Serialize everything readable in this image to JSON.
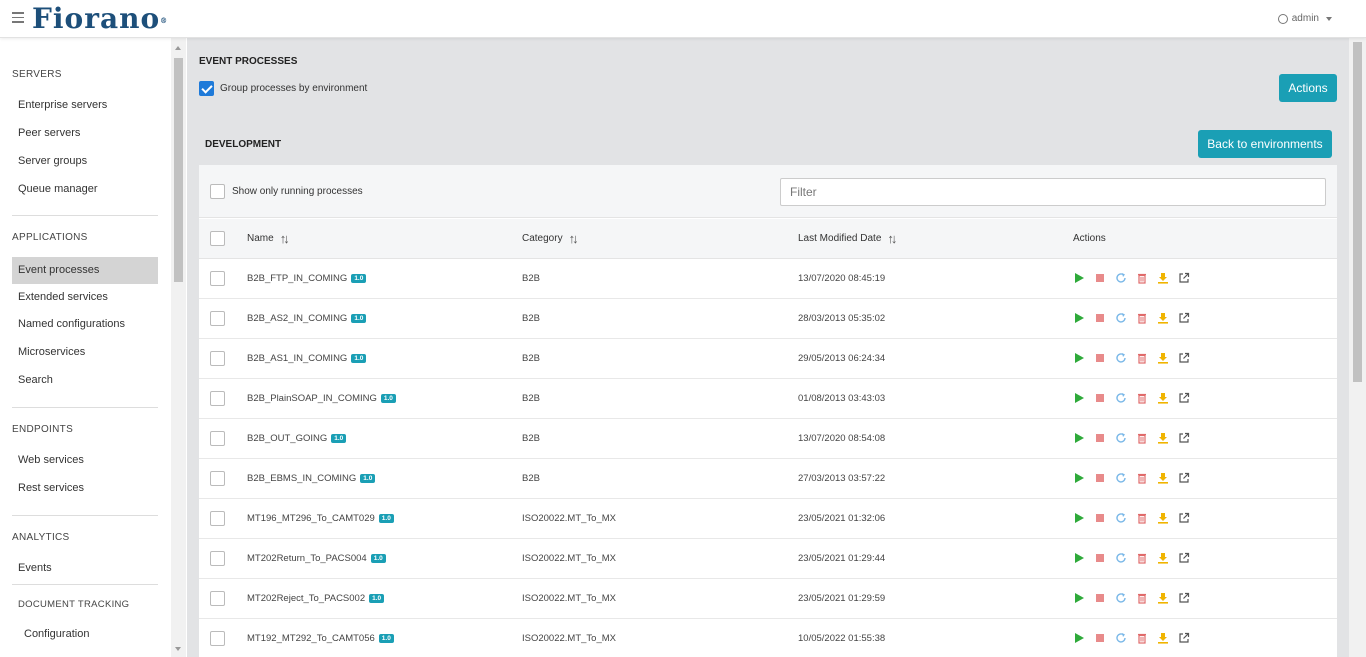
{
  "app": {
    "logo_text": "Fiorano",
    "logo_mark": "®",
    "user": "admin"
  },
  "sidebar": {
    "sections": [
      {
        "title": "SERVERS",
        "items": [
          "Enterprise servers",
          "Peer servers",
          "Server groups",
          "Queue manager"
        ]
      },
      {
        "title": "APPLICATIONS",
        "items": [
          "Event processes",
          "Extended services",
          "Named configurations",
          "Microservices",
          "Search"
        ]
      },
      {
        "title": "ENDPOINTS",
        "items": [
          "Web services",
          "Rest services"
        ]
      },
      {
        "title": "ANALYTICS",
        "items": [
          "Events"
        ]
      },
      {
        "title": "DOCUMENT TRACKING",
        "items": [
          "Configuration"
        ]
      }
    ],
    "active_item": "Event processes"
  },
  "main": {
    "title": "EVENT PROCESSES",
    "group_label": "Group processes by environment",
    "group_checked": true,
    "actions_button": "Actions",
    "environment": "DEVELOPMENT",
    "back_button": "Back to environments",
    "running_only_label": "Show only running processes",
    "filter_placeholder": "Filter",
    "columns": {
      "name": "Name",
      "category": "Category",
      "modified": "Last Modified Date",
      "actions": "Actions"
    }
  },
  "rows": [
    {
      "name": "B2B_FTP_IN_COMING",
      "version": "1.0",
      "category": "B2B",
      "modified": "13/07/2020 08:45:19"
    },
    {
      "name": "B2B_AS2_IN_COMING",
      "version": "1.0",
      "category": "B2B",
      "modified": "28/03/2013 05:35:02"
    },
    {
      "name": "B2B_AS1_IN_COMING",
      "version": "1.0",
      "category": "B2B",
      "modified": "29/05/2013 06:24:34"
    },
    {
      "name": "B2B_PlainSOAP_IN_COMING",
      "version": "1.0",
      "category": "B2B",
      "modified": "01/08/2013 03:43:03"
    },
    {
      "name": "B2B_OUT_GOING",
      "version": "1.0",
      "category": "B2B",
      "modified": "13/07/2020 08:54:08"
    },
    {
      "name": "B2B_EBMS_IN_COMING",
      "version": "1.0",
      "category": "B2B",
      "modified": "27/03/2013 03:57:22"
    },
    {
      "name": "MT196_MT296_To_CAMT029",
      "version": "1.0",
      "category": "ISO20022.MT_To_MX",
      "modified": "23/05/2021 01:32:06"
    },
    {
      "name": "MT202Return_To_PACS004",
      "version": "1.0",
      "category": "ISO20022.MT_To_MX",
      "modified": "23/05/2021 01:29:44"
    },
    {
      "name": "MT202Reject_To_PACS002",
      "version": "1.0",
      "category": "ISO20022.MT_To_MX",
      "modified": "23/05/2021 01:29:59"
    },
    {
      "name": "MT192_MT292_To_CAMT056",
      "version": "1.0",
      "category": "ISO20022.MT_To_MX",
      "modified": "10/05/2022 01:55:38"
    }
  ],
  "row_actions": [
    "play-icon",
    "stop-icon",
    "refresh-icon",
    "delete-icon",
    "download-icon",
    "open-external-icon"
  ],
  "colors": {
    "accent": "#1a9fb5",
    "play": "#2eaa3a",
    "stop": "#e88a8a",
    "refresh": "#7ab8e8",
    "delete": "#e06a6a",
    "download": "#f0b400",
    "external": "#555555"
  }
}
